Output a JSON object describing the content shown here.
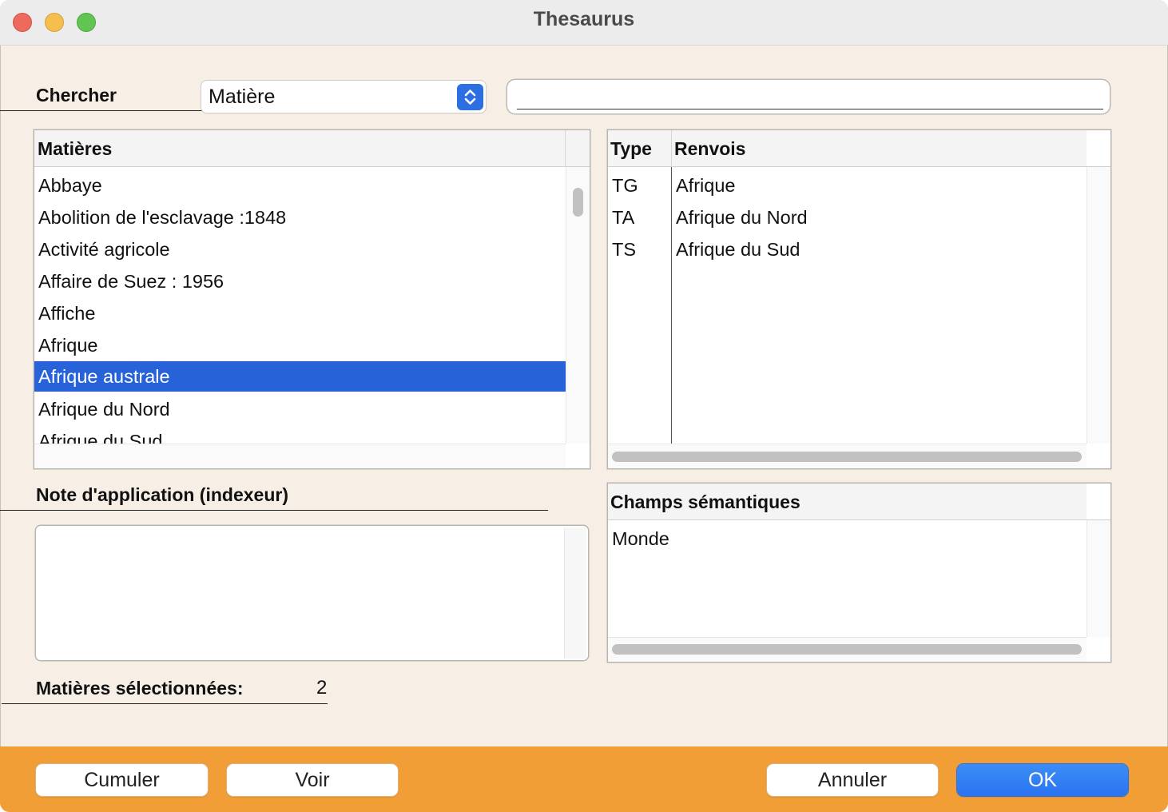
{
  "window": {
    "title": "Thesaurus"
  },
  "search": {
    "label": "Chercher",
    "field_type": "Matière",
    "query_value": "",
    "query_placeholder": ""
  },
  "matieres": {
    "header": "Matières",
    "items": [
      "Abbaye",
      "Abolition de l'esclavage :1848",
      "Activité agricole",
      "Affaire de Suez : 1956",
      "Affiche",
      "Afrique",
      "Afrique australe",
      "Afrique du Nord",
      "Afrique du Sud"
    ],
    "selected_index": 6
  },
  "renvois": {
    "headers": {
      "type": "Type",
      "renvois": "Renvois"
    },
    "rows": [
      {
        "type": "TG",
        "term": "Afrique"
      },
      {
        "type": "TA",
        "term": "Afrique du Nord"
      },
      {
        "type": "TS",
        "term": "Afrique du Sud"
      }
    ]
  },
  "note": {
    "label": "Note d'application (indexeur)",
    "value": ""
  },
  "champs": {
    "header": "Champs sémantiques",
    "items": [
      "Monde"
    ]
  },
  "selected_count": {
    "label": "Matières sélectionnées:",
    "value": "2"
  },
  "buttons": {
    "cumuler": "Cumuler",
    "voir": "Voir",
    "annuler": "Annuler",
    "ok": "OK"
  },
  "colors": {
    "selection": "#2862d8",
    "footer": "#f09e35",
    "primary_button": "#2a74f0",
    "background": "#f7efe6"
  },
  "icons": [
    "close-icon",
    "minimize-icon",
    "zoom-icon",
    "chevron-updown-icon"
  ]
}
